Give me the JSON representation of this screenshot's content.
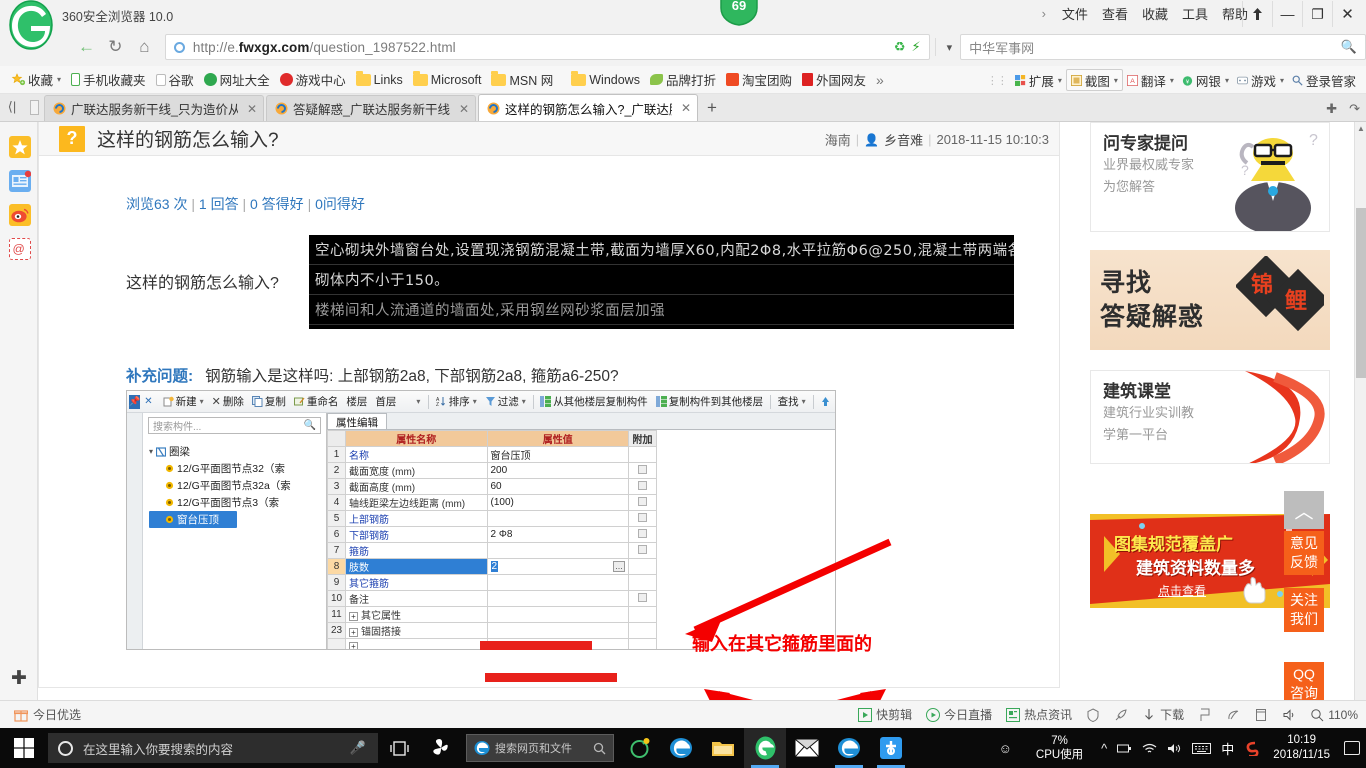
{
  "browser": {
    "name": "360安全浏览器 10.0",
    "score_badge": "69",
    "menu": [
      "文件",
      "查看",
      "收藏",
      "工具",
      "帮助"
    ],
    "url": {
      "prefix": "http://e.",
      "domain": "fwxgx.com",
      "path": "/question_1987522.html"
    },
    "search_placeholder": "中华军事网",
    "window_controls": {
      "pin": "⬆",
      "minimize": "—",
      "maximize": "❐",
      "close": "✕"
    }
  },
  "bookmarks": {
    "favorites_label": "收藏",
    "items": [
      {
        "label": "手机收藏夹",
        "icon": "phone-icon"
      },
      {
        "label": "谷歌",
        "icon": "page-icon"
      },
      {
        "label": "网址大全",
        "icon": "green-plus-icon"
      },
      {
        "label": "游戏中心",
        "icon": "red-g-icon"
      },
      {
        "label": "Links",
        "icon": "folder-icon"
      },
      {
        "label": "Microsoft",
        "icon": "folder-icon"
      },
      {
        "label": "MSN 网",
        "icon": "folder-icon"
      },
      {
        "label": "Windows",
        "icon": "folder-icon"
      },
      {
        "label": "品牌打折",
        "icon": "leaf-icon"
      },
      {
        "label": "淘宝团购",
        "icon": "taobao-icon"
      },
      {
        "label": "外国网友",
        "icon": "red-flag-icon"
      }
    ],
    "overflow": "»",
    "tools": [
      {
        "label": "扩展",
        "icon": "extension-icon"
      },
      {
        "label": "截图",
        "icon": "screenshot-icon"
      },
      {
        "label": "翻译",
        "icon": "translate-icon"
      },
      {
        "label": "网银",
        "icon": "bank-icon"
      },
      {
        "label": "游戏",
        "icon": "gamepad-icon"
      },
      {
        "label": "登录管家",
        "icon": "key-icon"
      }
    ]
  },
  "tabs": [
    {
      "label": "广联达服务新干线_只为造价从业",
      "active": false
    },
    {
      "label": "答疑解惑_广联达服务新干线",
      "active": false
    },
    {
      "label": "这样的钢筋怎么输入?_广联达服",
      "active": true
    }
  ],
  "tab_new_label": "+",
  "sidebar_rail": [
    {
      "name": "favorites-star-icon"
    },
    {
      "name": "news-icon"
    },
    {
      "name": "weibo-icon"
    },
    {
      "name": "mail-icon"
    }
  ],
  "question": {
    "title": "这样的钢筋怎么输入?",
    "badge": "?",
    "meta_location": "海南",
    "meta_user": "乡音难",
    "meta_time": "2018-11-15 10:10:3",
    "stats": {
      "views": "浏览63 次",
      "answers": "1 回答",
      "good_answers": "0 答得好",
      "good_questions": "0问得好"
    },
    "body_text": "这样的钢筋怎么输入?",
    "image_lines": [
      "空心砌块外墙窗台处,设置现浇钢筋混凝土带,截面为墙厚X60,内配2Φ8,水平拉筋Φ6@250,混凝土带两端各伸入",
      "砌体内不小于150。",
      "楼梯间和人流通道的墙面处,采用钢丝网砂浆面层加强"
    ],
    "supplement_label": "补充问题:",
    "supplement_text": "钢筋输入是这样吗: 上部钢筋2a8, 下部钢筋2a8, 箍筋a6-250?"
  },
  "software_shot": {
    "toolbar": [
      {
        "label": "新建",
        "caret": true
      },
      {
        "label": "删除",
        "caret": false
      },
      {
        "label": "复制",
        "caret": false
      },
      {
        "label": "重命名",
        "caret": false
      },
      {
        "label": "楼层",
        "caret": false
      },
      {
        "label": "首层",
        "caret": true
      },
      {
        "label": "排序",
        "caret": true
      },
      {
        "label": "过滤",
        "caret": true
      },
      {
        "label": "从其他楼层复制构件",
        "caret": false
      },
      {
        "label": "复制构件到其他楼层",
        "caret": false
      },
      {
        "label": "查找",
        "caret": true
      }
    ],
    "tree_search_placeholder": "搜索构件...",
    "tree": {
      "root": "圈梁",
      "children": [
        "12/G平面图节点32（索",
        "12/G平面图节点32a（索",
        "12/G平面图节点3（索",
        "窗台压顶"
      ],
      "selected": "窗台压顶"
    },
    "prop_tab": "属性编辑",
    "table": {
      "headers": [
        "",
        "属性名称",
        "属性值",
        "附加"
      ],
      "rows": [
        {
          "idx": "1",
          "name": "名称",
          "value": "窗台压顶",
          "blue": true,
          "checkbox": false
        },
        {
          "idx": "2",
          "name": "截面宽度 (mm)",
          "value": "200",
          "blue": false,
          "checkbox": true
        },
        {
          "idx": "3",
          "name": "截面高度 (mm)",
          "value": "60",
          "blue": false,
          "checkbox": true
        },
        {
          "idx": "4",
          "name": "轴线距梁左边线距离 (mm)",
          "value": "(100)",
          "blue": false,
          "checkbox": true
        },
        {
          "idx": "5",
          "name": "上部钢筋",
          "value": "",
          "blue": true,
          "checkbox": true,
          "redacted": true
        },
        {
          "idx": "6",
          "name": "下部钢筋",
          "value": "2 Φ8",
          "blue": true,
          "checkbox": true
        },
        {
          "idx": "7",
          "name": "箍筋",
          "value": "",
          "blue": true,
          "checkbox": true,
          "redacted": true
        },
        {
          "idx": "8",
          "name": "肢数",
          "value": "2",
          "blue": true,
          "checkbox": false,
          "selected": true
        },
        {
          "idx": "9",
          "name": "其它箍筋",
          "value": "",
          "blue": true,
          "checkbox": false
        },
        {
          "idx": "10",
          "name": "备注",
          "value": "",
          "blue": false,
          "checkbox": true
        },
        {
          "idx": "11",
          "name": "其它属性",
          "value": "",
          "blue": false,
          "checkbox": false,
          "expander": true
        },
        {
          "idx": "23",
          "name": "锚固搭接",
          "value": "",
          "blue": false,
          "checkbox": false,
          "expander": true
        }
      ]
    }
  },
  "annotation": {
    "note_text": "输入在其它箍筋里面的"
  },
  "ads": {
    "expert": {
      "title": "问专家提问",
      "line1": "业界最权威专家",
      "line2": "为您解答"
    },
    "jinli": {
      "line1": "寻找",
      "line2": "答疑解惑",
      "diamond": "锦鲤"
    },
    "classroom": {
      "title": "建筑课堂",
      "line1": "建筑行业实训教",
      "line2": "学第一平台"
    },
    "tuji": {
      "line1": "图集规范覆盖广",
      "line2": "建筑资料数量多",
      "cta": "点击查看"
    }
  },
  "float_tabs": {
    "to_top": "︿",
    "feedback": "意见\n反馈",
    "follow": "关注\n我们",
    "qq": "QQ\n咨询"
  },
  "status_bar": {
    "left": {
      "label": "今日优选",
      "icon": "gift-icon"
    },
    "right": [
      {
        "label": "快剪辑",
        "icon": "clip-icon"
      },
      {
        "label": "今日直播",
        "icon": "live-icon"
      },
      {
        "label": "热点资讯",
        "icon": "news-icon"
      },
      {
        "label": "",
        "icon": "shield-icon"
      },
      {
        "label": "",
        "icon": "rocket-icon"
      },
      {
        "label": "下载",
        "icon": "download-icon"
      },
      {
        "label": "",
        "icon": "flag-icon"
      },
      {
        "label": "",
        "icon": "speed-icon"
      },
      {
        "label": "",
        "icon": "window-icon"
      },
      {
        "label": "",
        "icon": "volume-icon"
      },
      {
        "label": "",
        "icon": "zoom-icon"
      },
      {
        "label": "110%",
        "icon": ""
      }
    ]
  },
  "taskbar": {
    "search_placeholder": "在这里输入你要搜索的内容",
    "apps": [
      {
        "name": "task-view-icon"
      },
      {
        "name": "windmill-icon"
      },
      {
        "name": "ie-search-icon",
        "label": "搜索网页和文件"
      },
      {
        "name": "360-shield-icon"
      },
      {
        "name": "ie-icon"
      },
      {
        "name": "explorer-icon"
      },
      {
        "name": "360-browser-icon"
      },
      {
        "name": "mail-icon"
      },
      {
        "name": "edge-icon"
      },
      {
        "name": "app-blue-icon"
      }
    ],
    "tray": {
      "people_icon": "people-icon",
      "cpu_percent": "7%",
      "cpu_label": "CPU使用",
      "time": "10:19",
      "date": "2018/11/15",
      "ime": "中"
    }
  }
}
